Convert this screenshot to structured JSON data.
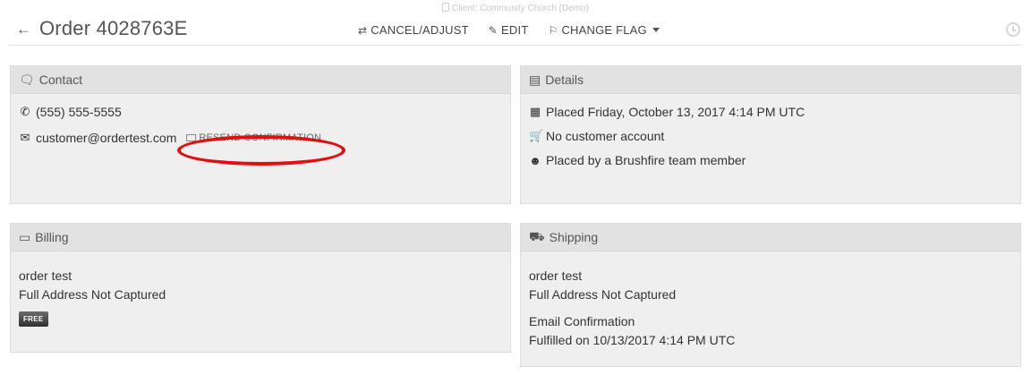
{
  "client_note": "Client: Community Church (Demo)",
  "header": {
    "title": "Order 4028763E",
    "actions": {
      "cancel_adjust": "CANCEL/ADJUST",
      "edit": "EDIT",
      "change_flag": "CHANGE FLAG"
    }
  },
  "contact": {
    "title": "Contact",
    "phone": "(555) 555-5555",
    "email": "customer@ordertest.com",
    "resend": "RESEND CONFIRMATION"
  },
  "details": {
    "title": "Details",
    "placed": "Placed Friday, October 13, 2017 4:14 PM UTC",
    "account": "No customer account",
    "placed_by": "Placed by a Brushfire team member"
  },
  "billing": {
    "title": "Billing",
    "name": "order test",
    "address": "Full Address Not Captured",
    "badge": "FREE"
  },
  "shipping": {
    "title": "Shipping",
    "name": "order test",
    "address": "Full Address Not Captured",
    "method": "Email Confirmation",
    "fulfilled": "Fulfilled on 10/13/2017 4:14 PM UTC"
  },
  "colors": {
    "annotation": "#e01010",
    "panel": "#efefef",
    "panel_header": "#e2e2e2"
  }
}
